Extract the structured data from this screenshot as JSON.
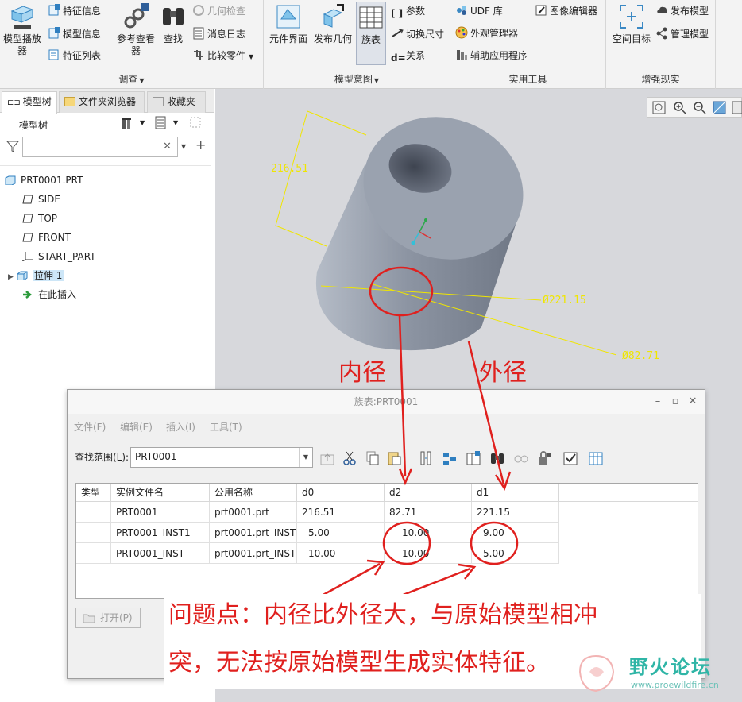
{
  "ribbon": {
    "buttons": {
      "model_player": "模型播放器",
      "feature_info": "特征信息",
      "model_info": "模型信息",
      "feature_list": "特征列表",
      "ref_viewer": "参考查看器",
      "find": "查找",
      "geometry_check": "几何检查",
      "message_log": "消息日志",
      "compare_parts": "比较零件",
      "component_interface": "元件界面",
      "publish_geometry": "发布几何",
      "family_table": "族表",
      "parameters": "参数",
      "switch_dimensions": "切换尺寸",
      "relations": "关系",
      "udf_library": "UDF 库",
      "appearance_manager": "外观管理器",
      "auxiliary_apps": "辅助应用程序",
      "image_editor": "图像编辑器",
      "spatial_target": "空间目标",
      "publish_model": "发布模型",
      "manage_model": "管理模型"
    },
    "groups": {
      "investigate": "调查",
      "model_intent": "模型意图",
      "utilities": "实用工具",
      "augmented_reality": "增强现实"
    }
  },
  "left_panel": {
    "tabs": [
      "模型树",
      "文件夹浏览器",
      "收藏夹"
    ],
    "header": "模型树",
    "filter_placeholder": "",
    "tree": [
      {
        "label": "PRT0001.PRT"
      },
      {
        "label": "SIDE"
      },
      {
        "label": "TOP"
      },
      {
        "label": "FRONT"
      },
      {
        "label": "START_PART"
      },
      {
        "label": "拉伸 1"
      },
      {
        "label": "在此插入"
      }
    ]
  },
  "graphics": {
    "dim_length": "216.51",
    "dim_outer": "Ø221.15",
    "dim_inner": "Ø82.71"
  },
  "dialog": {
    "title": "族表:PRT0001",
    "menu": [
      "文件(F)",
      "编辑(E)",
      "插入(I)",
      "工具(T)"
    ],
    "lookup_label": "查找范围(L):",
    "lookup_value": "PRT0001",
    "columns": [
      "类型",
      "实例文件名",
      "公用名称",
      "d0",
      "d2",
      "d1"
    ],
    "rows": [
      [
        "",
        "PRT0001",
        "prt0001.prt",
        "216.51",
        "82.71",
        "221.15"
      ],
      [
        "",
        "PRT0001_INST1",
        "prt0001.prt_INST1",
        "5.00",
        "10.00",
        "9.00"
      ],
      [
        "",
        "PRT0001_INST",
        "prt0001.prt_INST",
        "10.00",
        "10.00",
        "5.00"
      ]
    ],
    "open_button": "打开(P)"
  },
  "annotations": {
    "inner_label": "内径",
    "outer_label": "外径",
    "problem_line1": "问题点：内径比外径大，与原始模型相冲",
    "problem_line2": "突，无法按原始模型生成实体特征。"
  },
  "watermark": {
    "title": "野火论坛",
    "url": "www.proewildfire.cn"
  },
  "colors": {
    "annotation": "#e0201e",
    "dimension": "#f0e600",
    "model_surface": "#8f97a6",
    "selection": "#cde6f7",
    "watermark": "#2fb5a6"
  }
}
